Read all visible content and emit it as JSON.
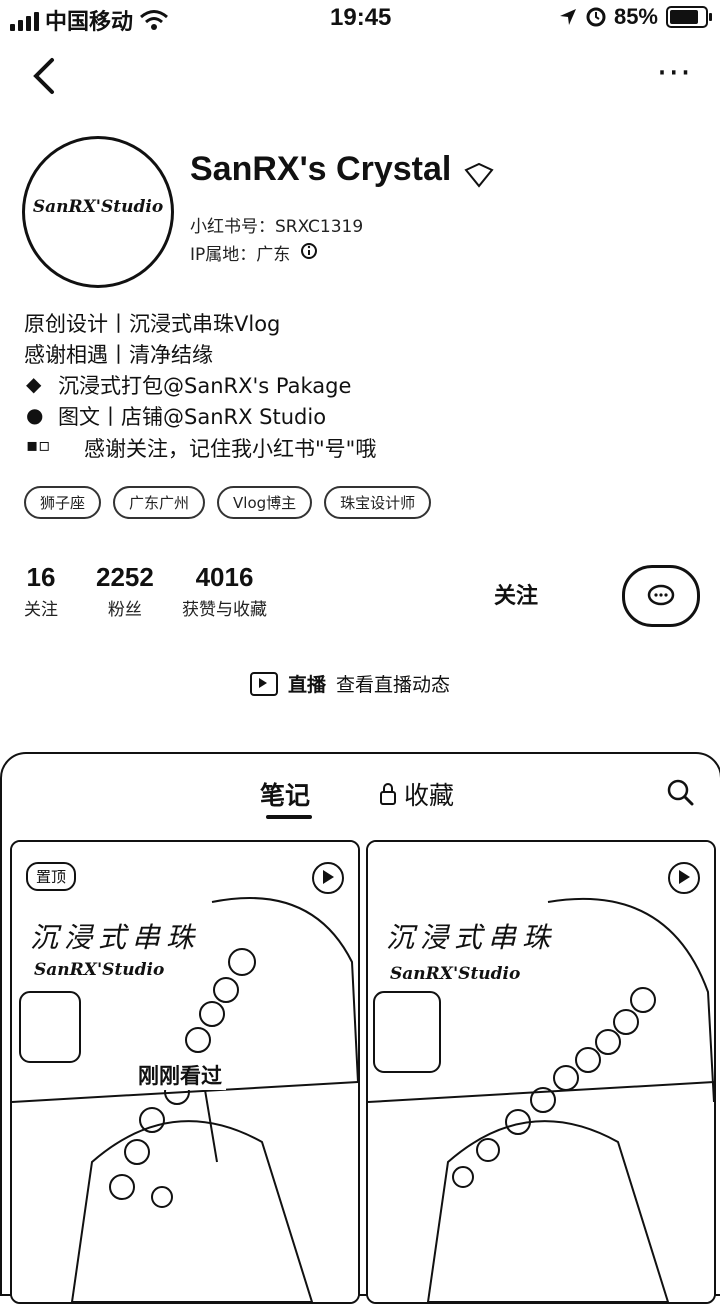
{
  "status_bar": {
    "carrier": "中国移动",
    "time": "19:45",
    "battery": "85%"
  },
  "nav": {
    "more": "···"
  },
  "profile": {
    "avatar_text": "SanRX'Studio",
    "name": "SanRX's Crystal",
    "id_line": "小红书号：SRXC1319",
    "ip_line": "IP属地：广东"
  },
  "bio": [
    "原创设计丨沉浸式串珠Vlog",
    "感谢相遇丨清净结缘",
    "沉浸式打包@SanRX's Pakage",
    "图文丨店铺@SanRX Studio",
    "感谢关注，记住我小红书\"号\"哦"
  ],
  "tags": [
    "狮子座",
    "广东广州",
    "Vlog博主",
    "珠宝设计师"
  ],
  "stats": [
    {
      "num": "16",
      "label": "关注"
    },
    {
      "num": "2252",
      "label": "粉丝"
    },
    {
      "num": "4016",
      "label": "获赞与收藏"
    }
  ],
  "actions": {
    "follow": "关注"
  },
  "live": {
    "label": "直播",
    "link": "查看直播动态"
  },
  "tabs": {
    "notes": "笔记",
    "collect": "收藏"
  },
  "cards": [
    {
      "pin": "置顶",
      "title": "沉浸式串珠",
      "brand": "SanRX'Studio",
      "seen": "刚刚看过"
    },
    {
      "title": "沉浸式串珠",
      "brand": "SanRX'Studio"
    }
  ]
}
